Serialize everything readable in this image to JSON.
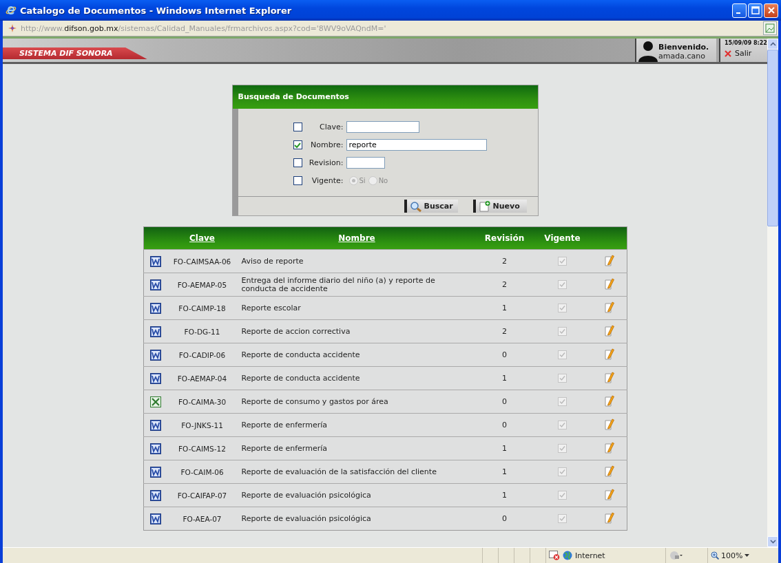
{
  "window": {
    "title": "Catalogo de Documentos - Windows Internet Explorer"
  },
  "address_bar": {
    "url": "http://www.**difson.gob.mx**/sistemas/Calidad_Manuales/frmarchivos.aspx?cod='8WV9oVAQndM='"
  },
  "header": {
    "brand": "SISTEMA DIF SONORA",
    "greeting": "Bienvenido.",
    "user": "amada.cano",
    "timestamp": "15/09/09 8:22",
    "logout": "Salir"
  },
  "search_panel": {
    "title": "Busqueda de Documentos",
    "fields": [
      {
        "kind": "text",
        "label": "Clave:",
        "checked": false
      },
      {
        "kind": "text",
        "label": "Nombre:",
        "checked": true,
        "value": "reporte"
      },
      {
        "kind": "text",
        "label": "Revision:",
        "checked": false
      },
      {
        "kind": "radio",
        "label": "Vigente:",
        "checked": false,
        "options": [
          {
            "label": "Si",
            "selected": true,
            "disabled": true
          },
          {
            "label": "No",
            "selected": false,
            "disabled": true
          }
        ]
      }
    ],
    "buttons": [
      {
        "kind": "search",
        "label": "Buscar"
      },
      {
        "kind": "new",
        "label": "Nuevo"
      }
    ]
  },
  "table": {
    "columns": [
      {
        "label": "Clave",
        "link": true
      },
      {
        "label": "Nombre",
        "link": true
      },
      {
        "label": "Revisión",
        "link": false
      },
      {
        "label": "Vigente",
        "link": false
      }
    ],
    "rows": [
      {
        "kind": "word",
        "clave": "FO-CAIMSAA-06",
        "nombre": "Aviso de reporte",
        "revision": "2",
        "vigente": true
      },
      {
        "kind": "word",
        "clave": "FO-AEMAP-05",
        "nombre": "Entrega del informe diario del niño (a) y reporte de conducta de accidente",
        "revision": "2",
        "vigente": true
      },
      {
        "kind": "word",
        "clave": "FO-CAIMP-18",
        "nombre": "Reporte escolar",
        "revision": "1",
        "vigente": true
      },
      {
        "kind": "word",
        "clave": "FO-DG-11",
        "nombre": "Reporte de accion correctiva",
        "revision": "2",
        "vigente": true
      },
      {
        "kind": "word",
        "clave": "FO-CADIP-06",
        "nombre": "Reporte de conducta accidente",
        "revision": "0",
        "vigente": true
      },
      {
        "kind": "word",
        "clave": "FO-AEMAP-04",
        "nombre": "Reporte de conducta accidente",
        "revision": "1",
        "vigente": true
      },
      {
        "kind": "excel",
        "clave": "FO-CAIMA-30",
        "nombre": "Reporte de consumo y gastos por área",
        "revision": "0",
        "vigente": true
      },
      {
        "kind": "word",
        "clave": "FO-JNKS-11",
        "nombre": "Reporte de enfermería",
        "revision": "0",
        "vigente": true
      },
      {
        "kind": "word",
        "clave": "FO-CAIMS-12",
        "nombre": "Reporte de enfermería",
        "revision": "1",
        "vigente": true
      },
      {
        "kind": "word",
        "clave": "FO-CAIM-06",
        "nombre": "Reporte de evaluación de la satisfacción del cliente",
        "revision": "1",
        "vigente": true
      },
      {
        "kind": "word",
        "clave": "FO-CAIFAP-07",
        "nombre": "Reporte de evaluación psicológica",
        "revision": "1",
        "vigente": true
      },
      {
        "kind": "word",
        "clave": "FO-AEA-07",
        "nombre": "Reporte de evaluación psicológica",
        "revision": "0",
        "vigente": true
      }
    ]
  },
  "status_bar": {
    "zone": "Internet",
    "zoom": "100%"
  }
}
